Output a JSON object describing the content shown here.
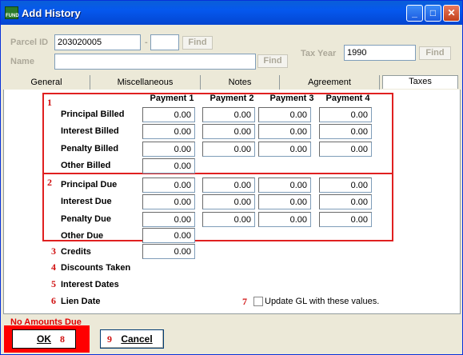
{
  "window": {
    "title": "Add History",
    "app_icon_text": "FUND"
  },
  "header": {
    "parcel_id_label": "Parcel ID",
    "parcel_id_value": "203020005",
    "parcel_sep": "-",
    "parcel_suffix_value": "",
    "find_label": "Find",
    "name_label": "Name",
    "name_value": "",
    "tax_year_label": "Tax Year",
    "tax_year_value": "1990"
  },
  "tabs": [
    "General",
    "Miscellaneous",
    "Notes",
    "Agreement",
    "Taxes"
  ],
  "active_tab": "Taxes",
  "columns": [
    "Payment 1",
    "Payment 2",
    "Payment 3",
    "Payment 4"
  ],
  "billed": {
    "principal_label": "Principal Billed",
    "principal": [
      "0.00",
      "0.00",
      "0.00",
      "0.00"
    ],
    "interest_label": "Interest Billed",
    "interest": [
      "0.00",
      "0.00",
      "0.00",
      "0.00"
    ],
    "penalty_label": "Penalty Billed",
    "penalty": [
      "0.00",
      "0.00",
      "0.00",
      "0.00"
    ],
    "other_label": "Other Billed",
    "other": "0.00"
  },
  "due": {
    "principal_label": "Principal Due",
    "principal": [
      "0.00",
      "0.00",
      "0.00",
      "0.00"
    ],
    "interest_label": "Interest Due",
    "interest": [
      "0.00",
      "0.00",
      "0.00",
      "0.00"
    ],
    "penalty_label": "Penalty Due",
    "penalty": [
      "0.00",
      "0.00",
      "0.00",
      "0.00"
    ],
    "other_label": "Other Due",
    "other": "0.00"
  },
  "credits_label": "Credits",
  "credits_value": "0.00",
  "discounts_label": "Discounts Taken",
  "interest_dates_label": "Interest Dates",
  "lien_date_label": "Lien Date",
  "update_gl_label": "Update GL with these values.",
  "markers": [
    "1",
    "2",
    "3",
    "4",
    "5",
    "6",
    "7",
    "8",
    "9"
  ],
  "status_text": "No Amounts Due",
  "ok_label": "OK",
  "cancel_label": "Cancel"
}
